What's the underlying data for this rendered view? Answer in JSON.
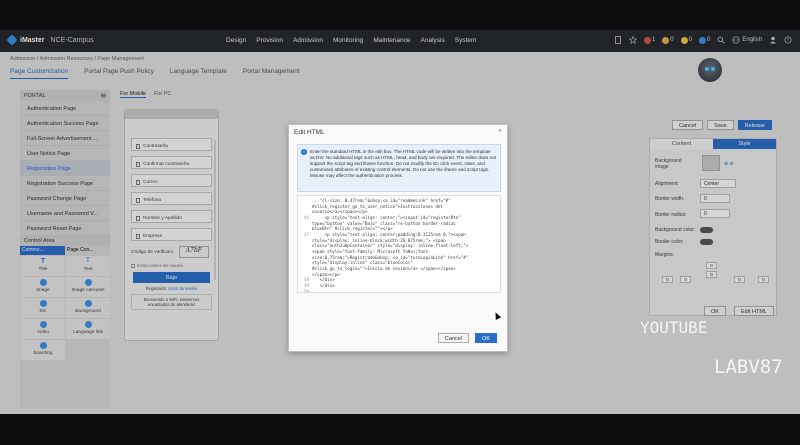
{
  "app": {
    "brand": "iMaster",
    "site": "NCE-Campus"
  },
  "nav": [
    "Design",
    "Provision",
    "Admission",
    "Monitoring",
    "Maintenance",
    "Analysis",
    "System"
  ],
  "topright": {
    "language": "English",
    "counts": [
      "1",
      "0",
      "0",
      "0"
    ],
    "badge_colors": [
      "#d9534f",
      "#f0ad4e",
      "#f5c542",
      "#3a8ee6"
    ]
  },
  "breadcrumb": "Admission / Admission Resources / Page Management",
  "tabs": [
    "Page Customization",
    "Portal Page Push Policy",
    "Language Template",
    "Portal Management"
  ],
  "left": {
    "portal_label": "PORTAL",
    "items": [
      "Authentication Page",
      "Authentication Success Page",
      "Full-Screen Advertisement ...",
      "User Notice Page",
      "Registration Page",
      "Registration Success Page",
      "Password Change Page",
      "Username and Password V...",
      "Password Reset Page"
    ],
    "control_area": "Control Area",
    "ctrl_tabs": [
      "Commo...",
      "Page Con..."
    ],
    "controls": [
      "Title",
      "Text",
      "Image",
      "Image carousel",
      "Div",
      "Background",
      "Video",
      "Language link",
      "boarding"
    ]
  },
  "preview": {
    "tabs": [
      "For Mobile",
      "For PC"
    ],
    "fields": [
      "Contraseña",
      "Confirmar contraseña",
      "Correo",
      "Teléfono",
      "Nombre y Apellido",
      "Empresa"
    ],
    "captcha_label": "Código de verificaci",
    "captcha_text": "A7bF",
    "notice": "Instrucciones del usuario",
    "submit": "Bajo",
    "login_prompt": "Registrado:",
    "login_link": "Inicio de sesión",
    "welcome": "Bienvenido a WiFi, estaremos encantados de atenderle!"
  },
  "right": {
    "buttons": [
      "Cancel",
      "Save",
      "Release"
    ],
    "tabs": [
      "Content",
      "Style"
    ],
    "bg_image": "Background image",
    "alignment_label": "Alignment:",
    "alignment_value": "Center",
    "border_width_label": "Border width:",
    "border_width_value": "0",
    "border_radius_label": "Border radius:",
    "border_radius_value": "0",
    "bg_color_label": "Background color:",
    "border_color_label": "Border color:",
    "margins_label": "Margins:",
    "margin_values": [
      "0",
      "0",
      "0",
      "0",
      "0",
      "0"
    ],
    "ok": "OK",
    "edit_html": "Edit HTML"
  },
  "modal": {
    "title": "Edit HTML",
    "info": "Enter the standard HTML in the edit box. The HTML code will be written into the template as DIV. No additional tags such as HTML, head, and body are required. The editor does not support the script tag and iframe function. Do not modify the ID, click event, class, and customized attributes of existing control elements. Do not use the iframe and script tags. Misuse may affect the authentication process.",
    "code_lines": [
      {
        "n": "",
        "t": "...\"cl-size: 0.47rem;\"&nbsp;<a id=\"readmeLink\" href=\"#\""
      },
      {
        "n": "",
        "t": "#click_register_go_to_user_notice\">Instrucciones del"
      },
      {
        "n": "",
        "t": "usuario</a></span></p>"
      },
      {
        "n": "46",
        "t": "     <p style=\"text-align: center;\"><input id=\"registerBtn\""
      },
      {
        "n": "",
        "t": "type=\"button\" value=\"Bajo\" class=\"re-button border-radius"
      },
      {
        "n": "",
        "t": "blueBtn\" #click_register=\"\"></p>"
      },
      {
        "n": "47",
        "t": "     <p style=\"text-align: center;padding:0.3125rem 0;\"><span"
      },
      {
        "n": "",
        "t": "style=\"display: inline-block;width:26.875rem;\"> <span"
      },
      {
        "n": "",
        "t": "class=\"authJumpContainer\" style=\"display: inline;float:left;\">"
      },
      {
        "n": "",
        "t": "<span style=\"font-family: Microsoft YaHei;font-"
      },
      {
        "n": "",
        "t": "size:0.75rem;\">Registrado&nbsp; <a id=\"turnLoginLink\" href=\"#\""
      },
      {
        "n": "",
        "t": "style=\"display:inline\" class=\"blueColor\""
      },
      {
        "n": "",
        "t": "#click_go_to_login=\"\">Inicio de sesión</a> </span></span>"
      },
      {
        "n": "",
        "t": "</span></p>"
      },
      {
        "n": "48",
        "t": "   </div>"
      },
      {
        "n": "49",
        "t": "   </div>"
      },
      {
        "n": "50",
        "t": ""
      }
    ],
    "cancel": "Cancel",
    "ok": "OK"
  },
  "watermarks": [
    "YOUTUBE",
    "LABV87"
  ]
}
